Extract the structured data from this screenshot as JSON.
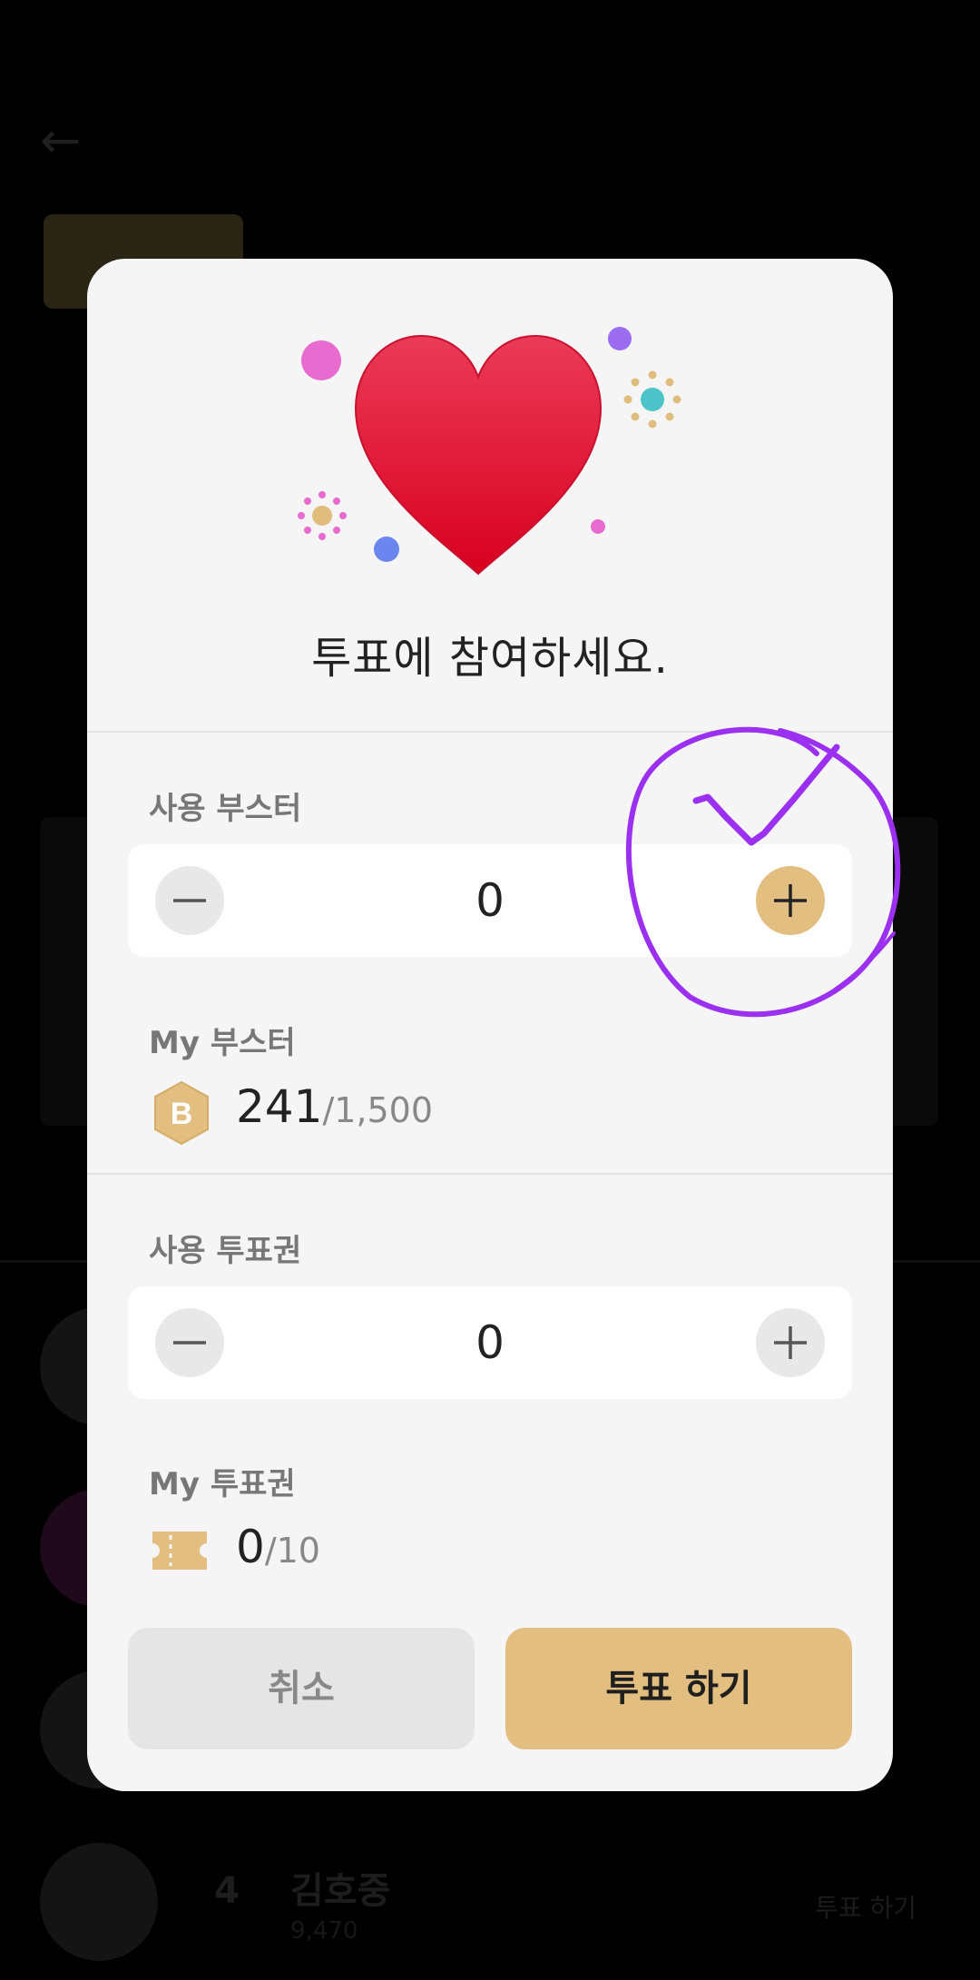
{
  "background": {
    "back_icon": "arrow-left-icon",
    "rows": [
      {
        "rank": "4",
        "name": "김호중",
        "sub": "9,470",
        "vote": "투표 하기"
      }
    ]
  },
  "modal": {
    "hero_icon": "heart-icon",
    "title": "투표에 참여하세요.",
    "booster_section": {
      "label": "사용 부스터",
      "value": "0",
      "minus_icon": "minus-icon",
      "plus_icon": "plus-icon"
    },
    "my_booster": {
      "label": "My 부스터",
      "badge_letter": "B",
      "current": "241",
      "separator": "/",
      "max": "1,500"
    },
    "ticket_section": {
      "label": "사용 투표권",
      "value": "0",
      "minus_icon": "minus-icon",
      "plus_icon": "plus-icon"
    },
    "my_ticket": {
      "label": "My 투표권",
      "current": "0",
      "separator": "/",
      "max": "10"
    },
    "buttons": {
      "cancel": "취소",
      "submit": "투표 하기"
    }
  },
  "colors": {
    "accent": "#e2bf80",
    "heart": "#e01e3c",
    "annotation": "#9b30f0",
    "modal_bg": "#f5f5f5"
  }
}
